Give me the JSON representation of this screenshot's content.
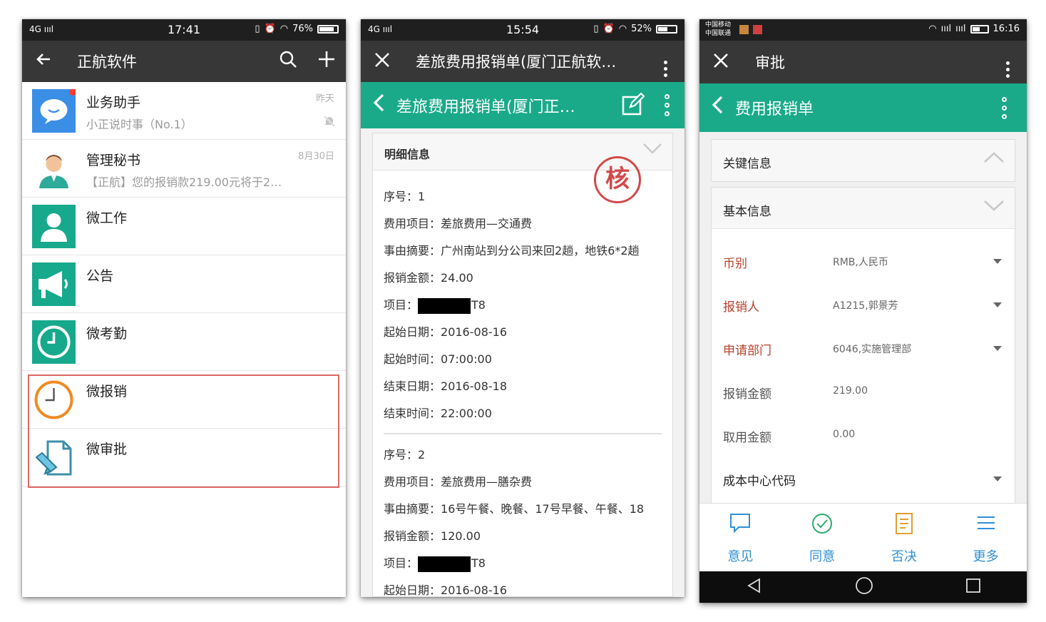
{
  "phone1": {
    "status": {
      "left": "4G ıııl",
      "time": "17:41",
      "battery": "76%",
      "battery_level": 0.76
    },
    "title": "正航软件",
    "items": [
      {
        "name": "业务助手",
        "sub": "小正说时事（No.1）",
        "date": "昨天",
        "icon": "chat-bubble-icon"
      },
      {
        "name": "管理秘书",
        "sub": "【正航】您的报销款219.00元将于2…",
        "date": "8月30日",
        "icon": "person-avatar-icon"
      },
      {
        "name": "微工作",
        "sub": "",
        "date": "",
        "icon": "user-icon"
      },
      {
        "name": "公告",
        "sub": "",
        "date": "",
        "icon": "megaphone-icon"
      },
      {
        "name": "微考勤",
        "sub": "",
        "date": "",
        "icon": "clock-icon"
      },
      {
        "name": "微报销",
        "sub": "",
        "date": "",
        "icon": "orange-clock-icon"
      },
      {
        "name": "微审批",
        "sub": "",
        "date": "",
        "icon": "document-edit-icon"
      }
    ],
    "colors": {
      "titlebar": "#373737",
      "highlight": "#e06666",
      "icon_teal": "#17a98c",
      "icon_blue": "#3a8ee6",
      "badge_red": "#ff3b30"
    }
  },
  "phone2": {
    "status": {
      "left": "4G ıııl",
      "time": "15:54",
      "battery": "52%",
      "battery_level": 0.52
    },
    "title": "差旅费用报销单(厦门正航软…",
    "subtitle": "差旅费用报销单(厦门正…",
    "section": "明细信息",
    "stamp": "核",
    "records": [
      {
        "seq_label": "序号：",
        "seq": "1",
        "item_label": "费用项目：",
        "item": "差旅费用—交通费",
        "summary_label": "事由摘要：",
        "summary": "广州南站到分公司来回2趟，地铁6*2趟",
        "amount_label": "报销金额：",
        "amount": "24.00",
        "project_label": "项目：",
        "project_suffix": "T8",
        "start_date_label": "起始日期：",
        "start_date": "2016-08-16",
        "start_time_label": "起始时间：",
        "start_time": "07:00:00",
        "end_date_label": "结束日期：",
        "end_date": "2016-08-18",
        "end_time_label": "结束时间：",
        "end_time": "22:00:00"
      },
      {
        "seq_label": "序号：",
        "seq": "2",
        "item_label": "费用项目：",
        "item": "差旅费用—膳杂费",
        "summary_label": "事由摘要：",
        "summary": "16号午餐、晚餐、17号早餐、午餐、18",
        "amount_label": "报销金额：",
        "amount": "120.00",
        "project_label": "项目：",
        "project_suffix": "T8",
        "start_date_label": "起始日期：",
        "start_date": "2016-08-16"
      }
    ]
  },
  "phone3": {
    "status": {
      "left_top": "中国移动",
      "left_bottom": "中国联通",
      "time": "16:16"
    },
    "title": "审批",
    "subtitle": "费用报销单",
    "sections": {
      "key": "关键信息",
      "basic": "基本信息"
    },
    "fields": [
      {
        "label": "币别",
        "value": "RMB,人民币",
        "required": true,
        "dropdown": true
      },
      {
        "label": "报销人",
        "value": "A1215,郭景芳",
        "required": true,
        "dropdown": true
      },
      {
        "label": "申请部门",
        "value": "6046,实施管理部",
        "required": true,
        "dropdown": true
      },
      {
        "label": "报销金额",
        "value": "219.00",
        "required": false,
        "dropdown": false
      },
      {
        "label": "取用金额",
        "value": "0.00",
        "required": false,
        "dropdown": false
      },
      {
        "label": "成本中心代码",
        "value": "",
        "required": false,
        "dropdown": true
      }
    ],
    "actions": [
      {
        "label": "意见",
        "icon": "comment-icon"
      },
      {
        "label": "同意",
        "icon": "check-circle-icon"
      },
      {
        "label": "否决",
        "icon": "document-icon"
      },
      {
        "label": "更多",
        "icon": "menu-lines-icon"
      }
    ],
    "colors": {
      "green": "#1aaa8a",
      "required_label": "#b8412b",
      "action_blue": "#2f8fd4"
    }
  }
}
